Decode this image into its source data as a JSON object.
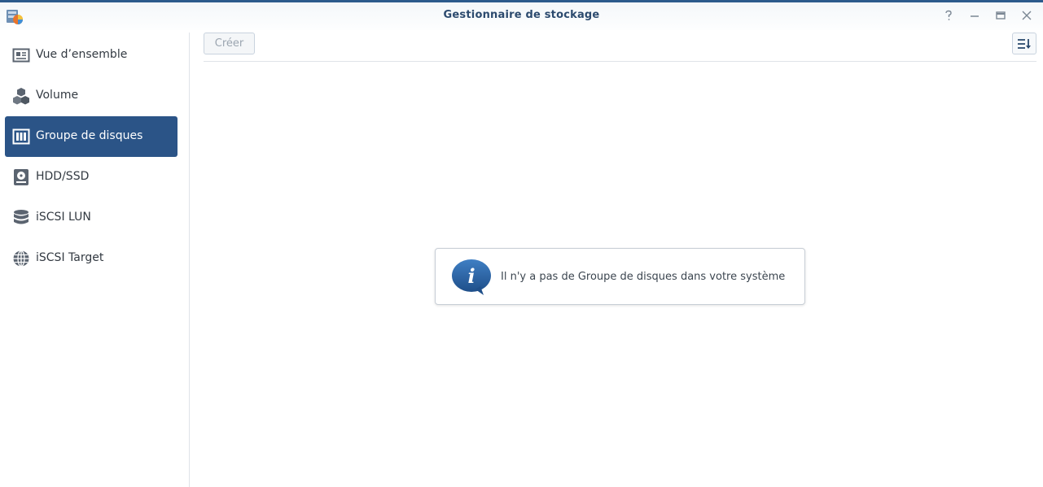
{
  "window": {
    "title": "Gestionnaire de stockage"
  },
  "controls": {
    "help": "help-icon",
    "minimize": "minimize-icon",
    "maximize": "maximize-icon",
    "close": "close-icon"
  },
  "sidebar": {
    "items": [
      {
        "label": "Vue d’ensemble",
        "icon": "overview-icon",
        "active": false
      },
      {
        "label": "Volume",
        "icon": "volume-cubes-icon",
        "active": false
      },
      {
        "label": "Groupe de disques",
        "icon": "disk-group-icon",
        "active": true
      },
      {
        "label": "HDD/SSD",
        "icon": "hdd-icon",
        "active": false
      },
      {
        "label": "iSCSI LUN",
        "icon": "database-icon",
        "active": false
      },
      {
        "label": "iSCSI Target",
        "icon": "globe-icon",
        "active": false
      }
    ]
  },
  "toolbar": {
    "create_label": "Créer",
    "sort_icon": "sort-icon"
  },
  "empty_state": {
    "message": "Il n'y a pas de Groupe de disques dans votre système",
    "icon": "info-bubble-icon"
  },
  "colors": {
    "accent": "#2b5487",
    "title": "#2c4a6e"
  }
}
